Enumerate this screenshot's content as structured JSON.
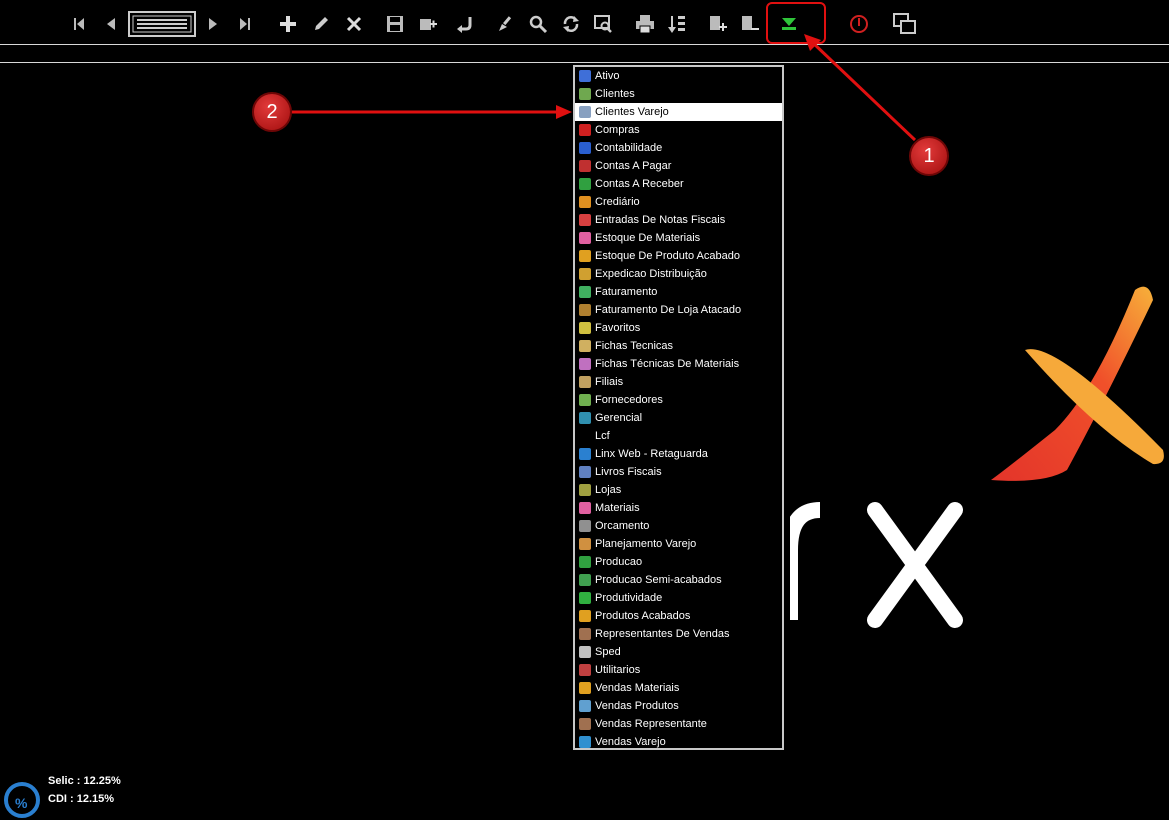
{
  "toolbar": {
    "buttons": [
      {
        "name": "first-record",
        "icon": "first-icon"
      },
      {
        "name": "prev-record",
        "icon": "prev-icon"
      },
      {
        "name": "record-list",
        "icon": "list-icon"
      },
      {
        "name": "next-record",
        "icon": "next-icon"
      },
      {
        "name": "last-record",
        "icon": "last-icon"
      },
      {
        "name": "add",
        "icon": "plus-icon"
      },
      {
        "name": "edit",
        "icon": "pencil-icon"
      },
      {
        "name": "delete",
        "icon": "x-icon"
      },
      {
        "name": "save",
        "icon": "floppy-icon"
      },
      {
        "name": "new-copy",
        "icon": "add-copy-icon"
      },
      {
        "name": "undo",
        "icon": "undo-icon"
      },
      {
        "name": "clear",
        "icon": "brush-icon"
      },
      {
        "name": "search",
        "icon": "magnifier-icon"
      },
      {
        "name": "refresh",
        "icon": "refresh-icon"
      },
      {
        "name": "preview",
        "icon": "preview-icon"
      },
      {
        "name": "print",
        "icon": "printer-icon"
      },
      {
        "name": "sort",
        "icon": "sort-icon"
      },
      {
        "name": "add-item",
        "icon": "add-item-icon"
      },
      {
        "name": "remove-item",
        "icon": "remove-item-icon"
      },
      {
        "name": "modules-dropdown",
        "icon": "green-down-arrow-icon"
      },
      {
        "name": "exit",
        "icon": "power-icon"
      },
      {
        "name": "windows",
        "icon": "windows-icon"
      }
    ]
  },
  "menu": {
    "selected_index": 2,
    "items": [
      {
        "label": "Ativo",
        "color": "#3f6fd8"
      },
      {
        "label": "Clientes",
        "color": "#6fa84f"
      },
      {
        "label": "Clientes Varejo",
        "color": "#88a0c0"
      },
      {
        "label": "Compras",
        "color": "#d02020"
      },
      {
        "label": "Contabilidade",
        "color": "#2a5fd0"
      },
      {
        "label": "Contas A Pagar",
        "color": "#c03030"
      },
      {
        "label": "Contas A Receber",
        "color": "#30a040"
      },
      {
        "label": "Crediário",
        "color": "#e09020"
      },
      {
        "label": "Entradas De Notas Fiscais",
        "color": "#d84040"
      },
      {
        "label": "Estoque De Materiais",
        "color": "#e060a0"
      },
      {
        "label": "Estoque De Produto Acabado",
        "color": "#e0a020"
      },
      {
        "label": "Expedicao Distribuição",
        "color": "#d0a030"
      },
      {
        "label": "Faturamento",
        "color": "#40b060"
      },
      {
        "label": "Faturamento De Loja Atacado",
        "color": "#b08030"
      },
      {
        "label": "Favoritos",
        "color": "#d0c040"
      },
      {
        "label": "Fichas Tecnicas",
        "color": "#d0b060"
      },
      {
        "label": "Fichas Técnicas De Materiais",
        "color": "#c070c0"
      },
      {
        "label": "Filiais",
        "color": "#c0a060"
      },
      {
        "label": "Fornecedores",
        "color": "#70b050"
      },
      {
        "label": "Gerencial",
        "color": "#3090b0"
      },
      {
        "label": "Lcf",
        "color": "#000000"
      },
      {
        "label": "Linx Web - Retaguarda",
        "color": "#2a80d0"
      },
      {
        "label": "Livros Fiscais",
        "color": "#6080c0"
      },
      {
        "label": "Lojas",
        "color": "#a0a040"
      },
      {
        "label": "Materiais",
        "color": "#e060a0"
      },
      {
        "label": "Orcamento",
        "color": "#909090"
      },
      {
        "label": "Planejamento Varejo",
        "color": "#d09040"
      },
      {
        "label": "Producao",
        "color": "#30a040"
      },
      {
        "label": "Producao Semi-acabados",
        "color": "#40a050"
      },
      {
        "label": "Produtividade",
        "color": "#30b040"
      },
      {
        "label": "Produtos Acabados",
        "color": "#e0a020"
      },
      {
        "label": "Representantes De Vendas",
        "color": "#a07050"
      },
      {
        "label": "Sped",
        "color": "#c0c0c0"
      },
      {
        "label": "Utilitarios",
        "color": "#c04040"
      },
      {
        "label": "Vendas Materiais",
        "color": "#e0a020"
      },
      {
        "label": "Vendas Produtos",
        "color": "#60a0d0"
      },
      {
        "label": "Vendas Representante",
        "color": "#a07050"
      },
      {
        "label": "Vendas Varejo",
        "color": "#3090d0"
      }
    ]
  },
  "status": {
    "selic": "Selic : 12.25%",
    "cdi": "CDI : 12.15%",
    "icon_glyph": "%"
  },
  "annotations": {
    "badge1": "1",
    "badge2": "2"
  },
  "colors": {
    "accent_green": "#2fc43a",
    "annotation_red": "#e01010"
  }
}
